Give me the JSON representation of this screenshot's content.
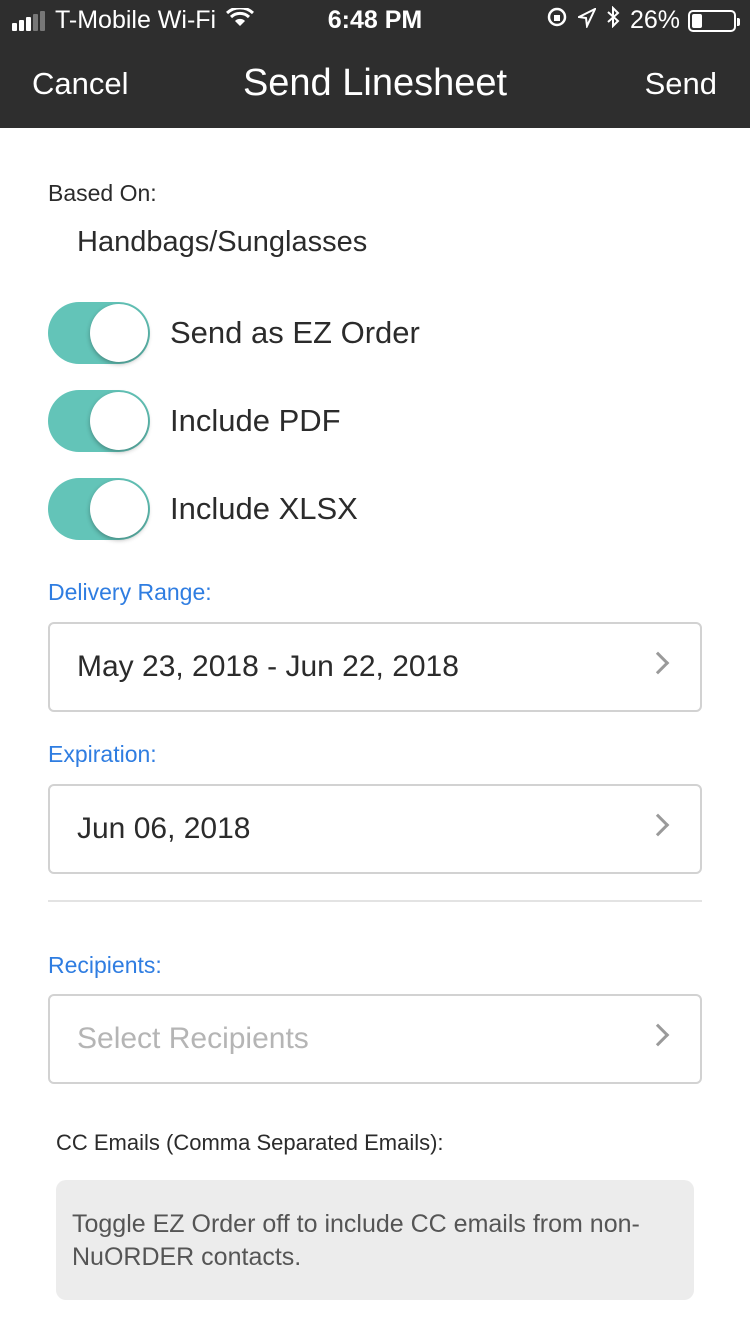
{
  "status_bar": {
    "carrier": "T-Mobile Wi-Fi",
    "time": "6:48 PM",
    "battery": "26%",
    "battery_level": 0.26,
    "icons": [
      "signal-icon",
      "wifi-icon",
      "orientation-lock-icon",
      "location-icon",
      "bluetooth-icon",
      "battery-icon"
    ]
  },
  "nav": {
    "cancel": "Cancel",
    "title": "Send Linesheet",
    "send": "Send"
  },
  "based_on": {
    "label": "Based On:",
    "value": "Handbags/Sunglasses"
  },
  "toggles": [
    {
      "label": "Send as EZ Order",
      "on": true
    },
    {
      "label": "Include PDF",
      "on": true
    },
    {
      "label": "Include XLSX",
      "on": true
    }
  ],
  "delivery_range": {
    "label": "Delivery Range:",
    "value": "May 23, 2018 - Jun 22, 2018"
  },
  "expiration": {
    "label": "Expiration:",
    "value": "Jun 06, 2018"
  },
  "recipients": {
    "label": "Recipients:",
    "placeholder": "Select Recipients"
  },
  "cc": {
    "label": "CC Emails (Comma Separated Emails):",
    "note": "Toggle EZ Order off to include CC emails from non-NuORDER contacts."
  },
  "colors": {
    "header_bg": "#2e2e2e",
    "toggle_on": "#63c4b8",
    "label_blue": "#2f7de1"
  }
}
